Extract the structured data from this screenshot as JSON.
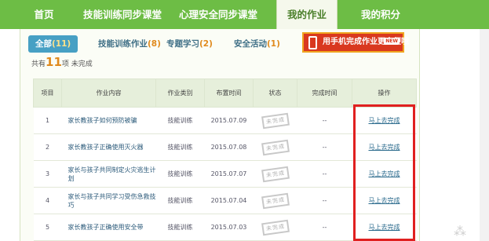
{
  "nav": {
    "items": [
      {
        "label": "首页",
        "active": false
      },
      {
        "label": "技能训练同步课堂",
        "active": false
      },
      {
        "label": "心理安全同步课堂",
        "active": false
      },
      {
        "label": "我的作业",
        "active": true
      },
      {
        "label": "我的积分",
        "active": false
      }
    ]
  },
  "tabs": [
    {
      "label": "全部",
      "count": "(11)",
      "active": true
    },
    {
      "label": "技能训练作业",
      "count": "(8)",
      "active": false
    },
    {
      "label": "专题学习",
      "count": "(2)",
      "active": false
    },
    {
      "label": "安全活动",
      "count": "(1)",
      "active": false
    }
  ],
  "mobile_button": {
    "label": "用手机完成作业更方便哦",
    "badge": "NEW"
  },
  "summary": {
    "prefix": "共有",
    "count": "11",
    "suffix": "项 未完成"
  },
  "table": {
    "headers": [
      "项目",
      "作业内容",
      "作业类别",
      "布置时间",
      "状态",
      "完成时间",
      "操作"
    ],
    "rows": [
      {
        "no": "1",
        "title": "家长教孩子如何预防被骗",
        "category": "技能训练",
        "date": "2015.07.09",
        "status": "未完成",
        "done_time": "--",
        "action": "马上去完成"
      },
      {
        "no": "2",
        "title": "家长教孩子正确使用灭火器",
        "category": "技能训练",
        "date": "2015.07.08",
        "status": "未完成",
        "done_time": "--",
        "action": "马上去完成"
      },
      {
        "no": "3",
        "title": "家长与孩子共同制定火灾逃生计划",
        "category": "技能训练",
        "date": "2015.07.07",
        "status": "未完成",
        "done_time": "--",
        "action": "马上去完成"
      },
      {
        "no": "4",
        "title": "家长与孩子共同学习受伤急救技巧",
        "category": "技能训练",
        "date": "2015.07.04",
        "status": "未完成",
        "done_time": "--",
        "action": "马上去完成"
      },
      {
        "no": "5",
        "title": "家长教孩子正确使用安全带",
        "category": "技能训练",
        "date": "2015.07.03",
        "status": "未完成",
        "done_time": "--",
        "action": "马上去完成"
      }
    ]
  },
  "colors": {
    "nav_green": "#6dbd45",
    "active_tab": "#47a0c4",
    "highlight_red": "#e02020",
    "mobile_red": "#d9381f"
  }
}
